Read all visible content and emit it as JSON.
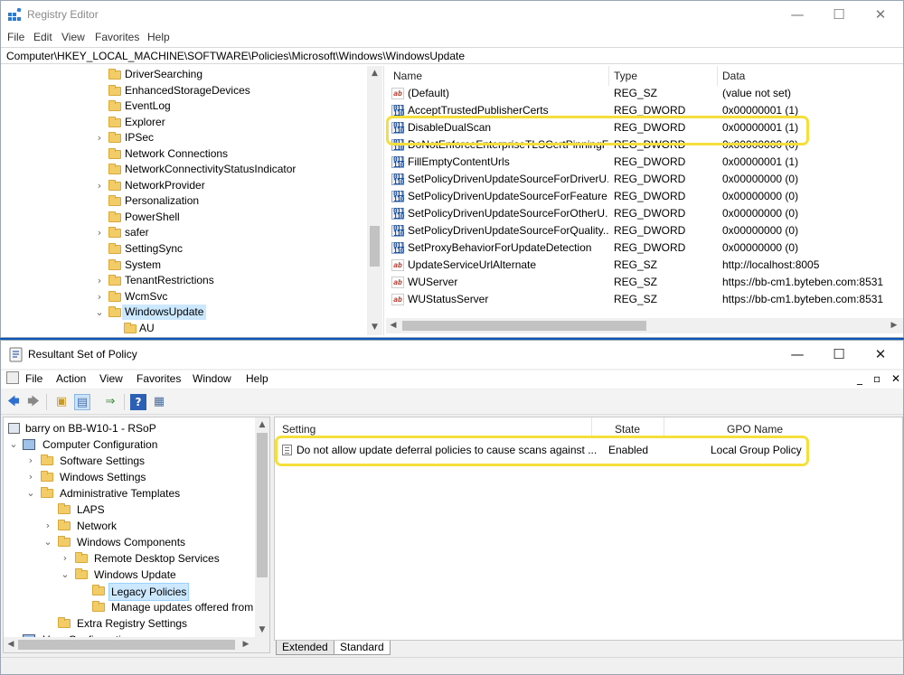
{
  "registry": {
    "title": "Registry Editor",
    "menu": [
      "File",
      "Edit",
      "View",
      "Favorites",
      "Help"
    ],
    "address": "Computer\\HKEY_LOCAL_MACHINE\\SOFTWARE\\Policies\\Microsoft\\Windows\\WindowsUpdate",
    "window_controls": {
      "minimize": "—",
      "maximize": "☐",
      "close": "✕"
    },
    "tree": [
      {
        "label": "DriverSearching",
        "expander": ""
      },
      {
        "label": "EnhancedStorageDevices",
        "expander": ""
      },
      {
        "label": "EventLog",
        "expander": ""
      },
      {
        "label": "Explorer",
        "expander": ""
      },
      {
        "label": "IPSec",
        "expander": "›"
      },
      {
        "label": "Network Connections",
        "expander": ""
      },
      {
        "label": "NetworkConnectivityStatusIndicator",
        "expander": ""
      },
      {
        "label": "NetworkProvider",
        "expander": "›"
      },
      {
        "label": "Personalization",
        "expander": ""
      },
      {
        "label": "PowerShell",
        "expander": ""
      },
      {
        "label": "safer",
        "expander": "›"
      },
      {
        "label": "SettingSync",
        "expander": ""
      },
      {
        "label": "System",
        "expander": ""
      },
      {
        "label": "TenantRestrictions",
        "expander": "›"
      },
      {
        "label": "WcmSvc",
        "expander": "›"
      },
      {
        "label": "WindowsUpdate",
        "expander": "⌄",
        "selected": true
      },
      {
        "label": "AU",
        "expander": "",
        "child": true
      }
    ],
    "columns": {
      "name": "Name",
      "type": "Type",
      "data": "Data"
    },
    "values": [
      {
        "icon": "sz",
        "name": "(Default)",
        "type": "REG_SZ",
        "data": "(value not set)"
      },
      {
        "icon": "dw",
        "name": "AcceptTrustedPublisherCerts",
        "type": "REG_DWORD",
        "data": "0x00000001 (1)"
      },
      {
        "icon": "dw",
        "name": "DisableDualScan",
        "type": "REG_DWORD",
        "data": "0x00000001 (1)"
      },
      {
        "icon": "dw",
        "name": "DoNotEnforceEnterpriseTLSCertPinningF...",
        "type": "REG_DWORD",
        "data": "0x00000000 (0)"
      },
      {
        "icon": "dw",
        "name": "FillEmptyContentUrls",
        "type": "REG_DWORD",
        "data": "0x00000001 (1)"
      },
      {
        "icon": "dw",
        "name": "SetPolicyDrivenUpdateSourceForDriverU...",
        "type": "REG_DWORD",
        "data": "0x00000000 (0)"
      },
      {
        "icon": "dw",
        "name": "SetPolicyDrivenUpdateSourceForFeature...",
        "type": "REG_DWORD",
        "data": "0x00000000 (0)"
      },
      {
        "icon": "dw",
        "name": "SetPolicyDrivenUpdateSourceForOtherU...",
        "type": "REG_DWORD",
        "data": "0x00000000 (0)"
      },
      {
        "icon": "dw",
        "name": "SetPolicyDrivenUpdateSourceForQuality...",
        "type": "REG_DWORD",
        "data": "0x00000000 (0)"
      },
      {
        "icon": "dw",
        "name": "SetProxyBehaviorForUpdateDetection",
        "type": "REG_DWORD",
        "data": "0x00000000 (0)"
      },
      {
        "icon": "sz",
        "name": "UpdateServiceUrlAlternate",
        "type": "REG_SZ",
        "data": "http://localhost:8005"
      },
      {
        "icon": "sz",
        "name": "WUServer",
        "type": "REG_SZ",
        "data": "https://bb-cm1.byteben.com:8531"
      },
      {
        "icon": "sz",
        "name": "WUStatusServer",
        "type": "REG_SZ",
        "data": "https://bb-cm1.byteben.com:8531"
      }
    ],
    "icon_text": {
      "sz": "ab",
      "dw": "011\n110"
    }
  },
  "rsop": {
    "title": "Resultant Set of Policy",
    "menu": [
      "File",
      "Action",
      "View",
      "Favorites",
      "Window",
      "Help"
    ],
    "window_controls": {
      "minimize": "—",
      "maximize": "☐",
      "close": "✕"
    },
    "inner_controls": {
      "minimize": "_",
      "restore": "▫",
      "close": "✕"
    },
    "toolbar_icons": [
      "back-arrow-icon",
      "forward-arrow-icon",
      "up-folder-icon",
      "show-hide-tree-icon",
      "export-list-icon",
      "help-icon",
      "properties-icon"
    ],
    "tree": [
      {
        "label": "barry on BB-W10-1 - RSoP",
        "indent": 0,
        "expander": "",
        "icon": "computer"
      },
      {
        "label": "Computer Configuration",
        "indent": 1,
        "expander": "⌄",
        "icon": "computer"
      },
      {
        "label": "Software Settings",
        "indent": 2,
        "expander": "›",
        "icon": "folder"
      },
      {
        "label": "Windows Settings",
        "indent": 2,
        "expander": "›",
        "icon": "folder"
      },
      {
        "label": "Administrative Templates",
        "indent": 2,
        "expander": "⌄",
        "icon": "folder"
      },
      {
        "label": "LAPS",
        "indent": 3,
        "expander": "",
        "icon": "folder"
      },
      {
        "label": "Network",
        "indent": 3,
        "expander": "›",
        "icon": "folder"
      },
      {
        "label": "Windows Components",
        "indent": 3,
        "expander": "⌄",
        "icon": "folder"
      },
      {
        "label": "Remote Desktop Services",
        "indent": 4,
        "expander": "›",
        "icon": "folder"
      },
      {
        "label": "Windows Update",
        "indent": 4,
        "expander": "⌄",
        "icon": "folder"
      },
      {
        "label": "Legacy Policies",
        "indent": 5,
        "expander": "",
        "icon": "folder",
        "selected": true
      },
      {
        "label": "Manage updates offered from",
        "indent": 5,
        "expander": "",
        "icon": "folder"
      },
      {
        "label": "Extra Registry Settings",
        "indent": 3,
        "expander": "",
        "icon": "folder"
      },
      {
        "label": "User Configuration",
        "indent": 1,
        "expander": "›",
        "icon": "computer"
      }
    ],
    "columns": {
      "setting": "Setting",
      "state": "State",
      "gpo": "GPO Name"
    },
    "policies": [
      {
        "setting": "Do not allow update deferral policies to cause scans against ...",
        "state": "Enabled",
        "gpo": "Local Group Policy"
      }
    ],
    "tabs": [
      "Extended",
      "Standard"
    ],
    "active_tab": "Standard"
  },
  "colors": {
    "highlight": "#f4df3b",
    "selection": "#cce8ff",
    "folder": "#f2cc67",
    "desktop": "#0a57b8"
  }
}
